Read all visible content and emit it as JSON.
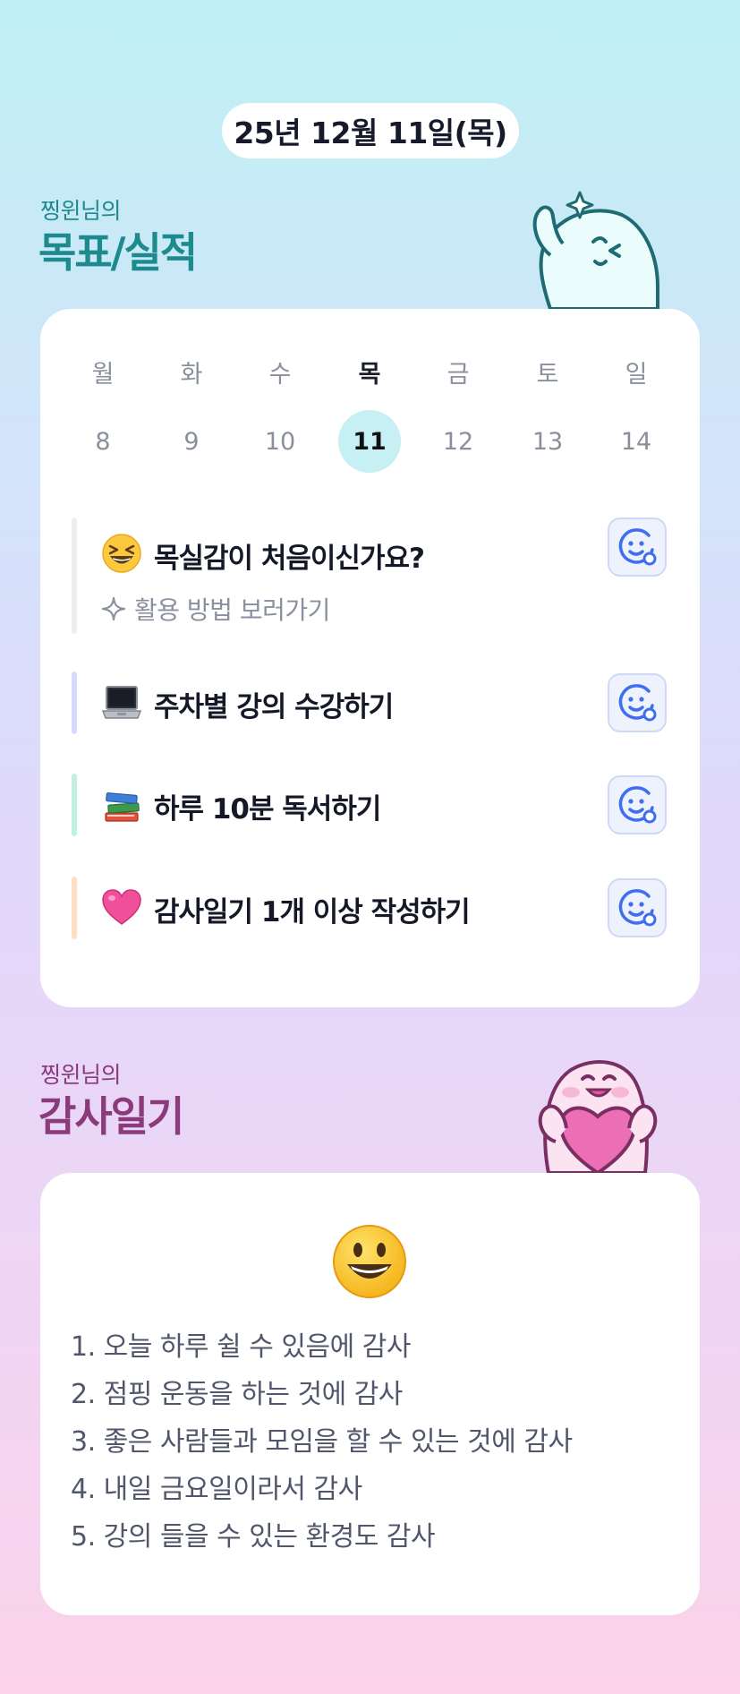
{
  "date": "25년 12월 11일(목)",
  "goals_section": {
    "subtitle": "찡윈님의",
    "title": "목표/실적"
  },
  "calendar": {
    "weekdays": [
      "월",
      "화",
      "수",
      "목",
      "금",
      "토",
      "일"
    ],
    "days": [
      "8",
      "9",
      "10",
      "11",
      "12",
      "13",
      "14"
    ],
    "active_index": 3
  },
  "goals": [
    {
      "icon": "laughing-face-emoji",
      "text": "목실감이 처음이신가요?",
      "bar_color": "#eceef2",
      "link": "활용 방법 보러가기"
    },
    {
      "icon": "laptop-emoji",
      "text": "주차별 강의 수강하기",
      "bar_color": "#d5dbfb"
    },
    {
      "icon": "books-emoji",
      "text": "하루 10분 독서하기",
      "bar_color": "#c3f0e2"
    },
    {
      "icon": "pink-heart-emoji",
      "text": "감사일기 1개 이상 작성하기",
      "bar_color": "#fde0c4"
    }
  ],
  "diary_section": {
    "subtitle": "찡윈님의",
    "title": "감사일기"
  },
  "diary": {
    "mood_icon": "smiling-face-emoji",
    "entries": [
      "1. 오늘 하루 쉴 수 있음에 감사",
      "2. 점핑 운동을 하는 것에 감사",
      "3. 좋은 사람들과 모임을 할 수 있는 것에 감사",
      "4. 내일 금요일이라서 감사",
      "5. 강의 들을 수 있는 환경도 감사"
    ]
  },
  "colors": {
    "accent_teal": "#1d8a8e",
    "accent_purple": "#8b3a7c",
    "button_blue": "#3f6ef0"
  }
}
